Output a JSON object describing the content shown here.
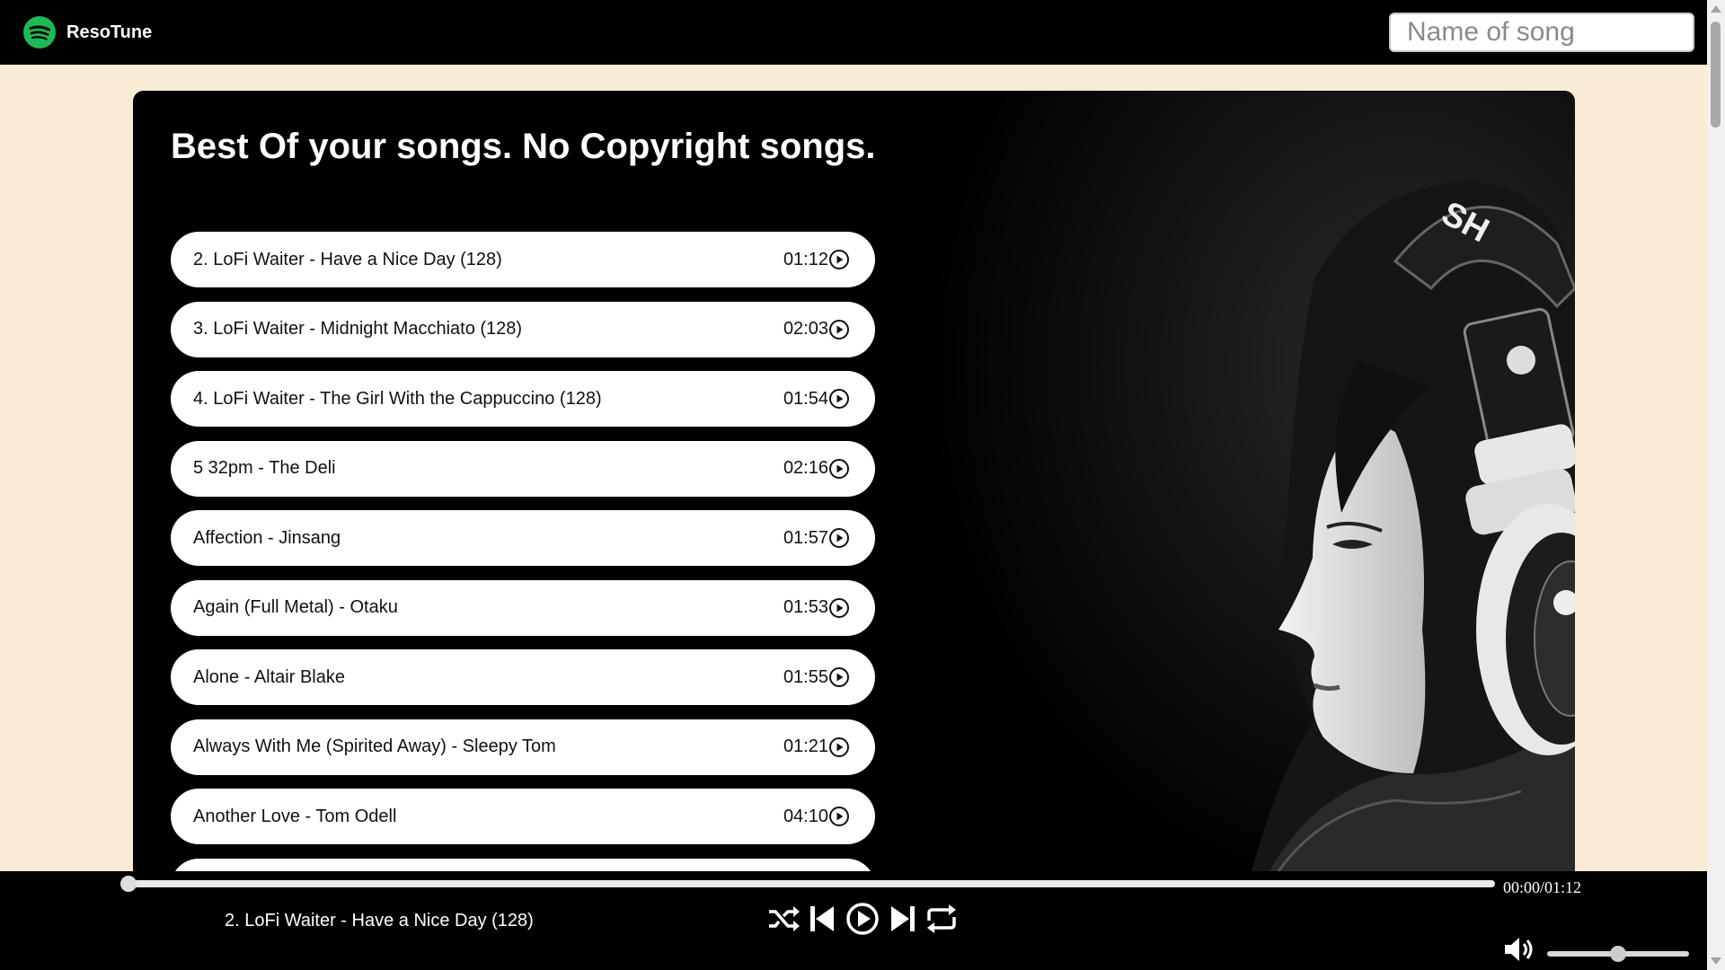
{
  "app": {
    "brand": "ResoTune",
    "logo_icon": "spotify-like-logo-icon"
  },
  "search": {
    "placeholder": "Name of song",
    "value": ""
  },
  "main": {
    "title": "Best Of your songs. No Copyright songs.",
    "songs": [
      {
        "title": "2. LoFi Waiter - Have a Nice Day (128)",
        "duration": "01:12"
      },
      {
        "title": "3. LoFi Waiter - Midnight Macchiato (128)",
        "duration": "02:03"
      },
      {
        "title": "4. LoFi Waiter - The Girl With the Cappuccino (128)",
        "duration": "01:54"
      },
      {
        "title": "5 32pm - The Deli",
        "duration": "02:16"
      },
      {
        "title": "Affection - Jinsang",
        "duration": "01:57"
      },
      {
        "title": "Again (Full Metal) - Otaku",
        "duration": "01:53"
      },
      {
        "title": "Alone - Altair Blake",
        "duration": "01:55"
      },
      {
        "title": "Always With Me (Spirited Away) - Sleepy Tom",
        "duration": "01:21"
      },
      {
        "title": "Another Love - Tom Odell",
        "duration": "04:10"
      }
    ],
    "hero_image": "woman-with-headphones-photo"
  },
  "player": {
    "now_playing": "2. LoFi Waiter - Have a Nice Day (128)",
    "time": "00:00/01:12",
    "progress_fraction": 0.0,
    "volume_fraction": 0.5,
    "controls": [
      "shuffle-icon",
      "previous-icon",
      "play-icon",
      "next-icon",
      "repeat-icon"
    ]
  },
  "colors": {
    "page_background": "#faebd7",
    "navbar": "#000000",
    "brand_green": "#1db954",
    "song_item_background": "#ffffff"
  }
}
